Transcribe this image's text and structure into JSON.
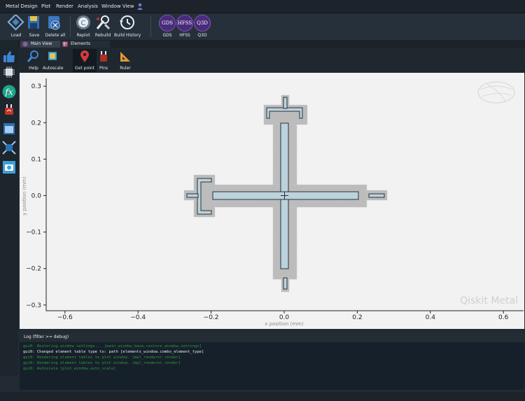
{
  "menu": [
    "Metal Design",
    "Plot",
    "Render",
    "Analysis",
    "Window View"
  ],
  "toolbar": {
    "buttons": [
      "Load",
      "Save",
      "Delete all",
      "Replot",
      "Rebuild",
      "Build History"
    ],
    "renderers": [
      "GDS",
      "HFSS",
      "Q3D"
    ]
  },
  "tabs": [
    "Main View",
    "Elements"
  ],
  "plot_tools": [
    "Help",
    "Autoscale",
    "Get point",
    "Pins",
    "Ruler"
  ],
  "plot": {
    "xlabel": "x position (mm)",
    "ylabel": "y position (mm)",
    "xticks": [
      "−0.6",
      "−0.4",
      "−0.2",
      "0.0",
      "0.2",
      "0.4",
      "0.6"
    ],
    "yticks": [
      "0.3",
      "0.2",
      "0.1",
      "0.0",
      "−0.1",
      "−0.2",
      "−0.3"
    ],
    "watermark": "Qiskit Metal"
  },
  "chart_data": {
    "type": "scatter",
    "xlabel": "x position (mm)",
    "ylabel": "y position (mm)",
    "xlim": [
      -0.65,
      0.65
    ],
    "ylim": [
      -0.32,
      0.32
    ]
  },
  "log": {
    "title": "Log  (filter >= debug)",
    "lines": [
      {
        "text": "gui0: Restoring window settings... [main_window_base.restore_window_settings]",
        "color": "#2e9a3a"
      },
      {
        "text": "gui0: Changed element table type to: path [elements_window.combo_element_type]",
        "color": "#e8eef3"
      },
      {
        "text": "gui0: Rendering element tables to plot window. [mpl_renderer.render]",
        "color": "#2e9a3a"
      },
      {
        "text": "gui0: Rendering element tables to plot window. [mpl_renderer.render]",
        "color": "#2e9a3a"
      },
      {
        "text": "gui0: Autoscale [plot_window.auto_scale]",
        "color": "#2e9a3a"
      }
    ]
  }
}
